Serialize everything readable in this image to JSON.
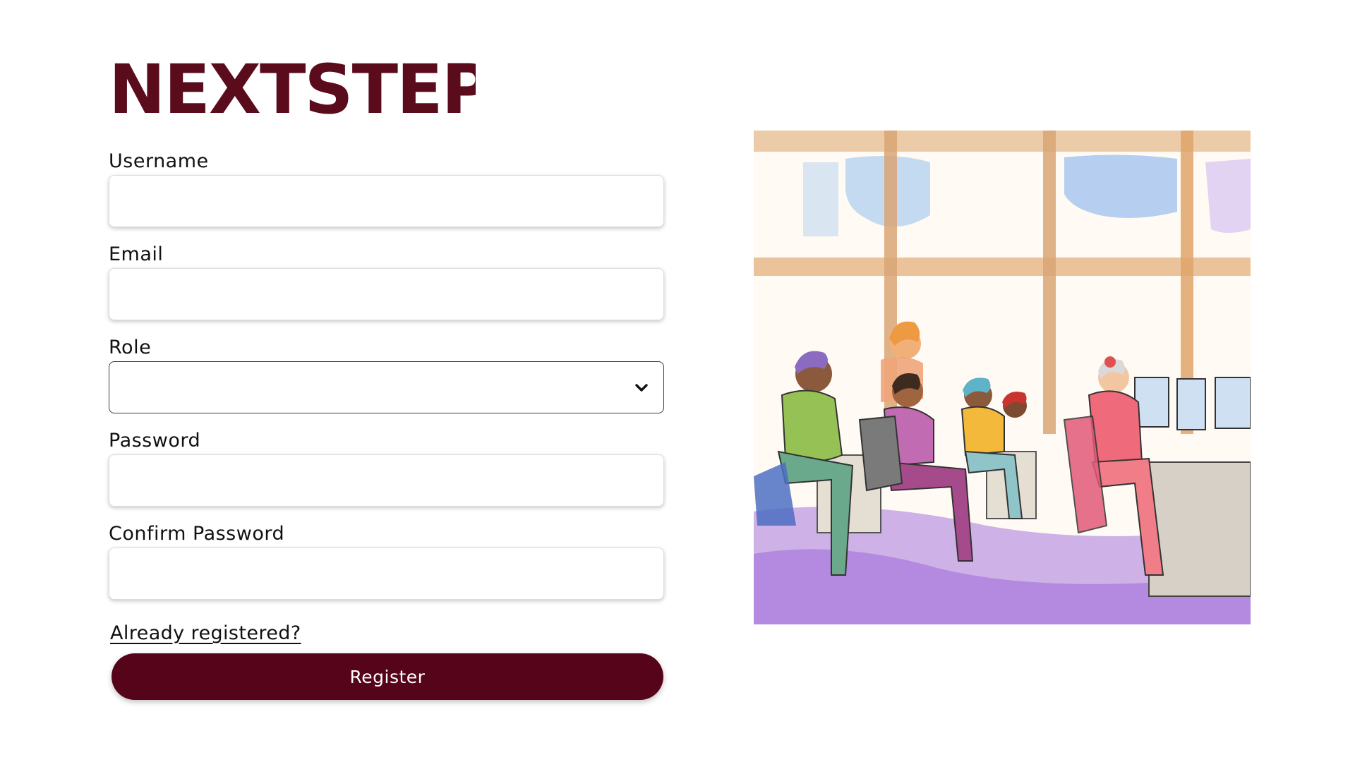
{
  "brand": {
    "logo_text": "NEXTSTEP",
    "color": "#5a0b1c"
  },
  "form": {
    "username": {
      "label": "Username",
      "value": "",
      "placeholder": ""
    },
    "email": {
      "label": "Email",
      "value": "",
      "placeholder": ""
    },
    "role": {
      "label": "Role",
      "selected": ""
    },
    "password": {
      "label": "Password",
      "value": "",
      "placeholder": ""
    },
    "confirm_password": {
      "label": "Confirm Password",
      "value": "",
      "placeholder": ""
    },
    "already_registered_link": "Already registered?",
    "register_button": "Register"
  },
  "colors": {
    "primary": "#56041a"
  },
  "illustration": {
    "icon": "office-people-watercolor-illustration"
  }
}
